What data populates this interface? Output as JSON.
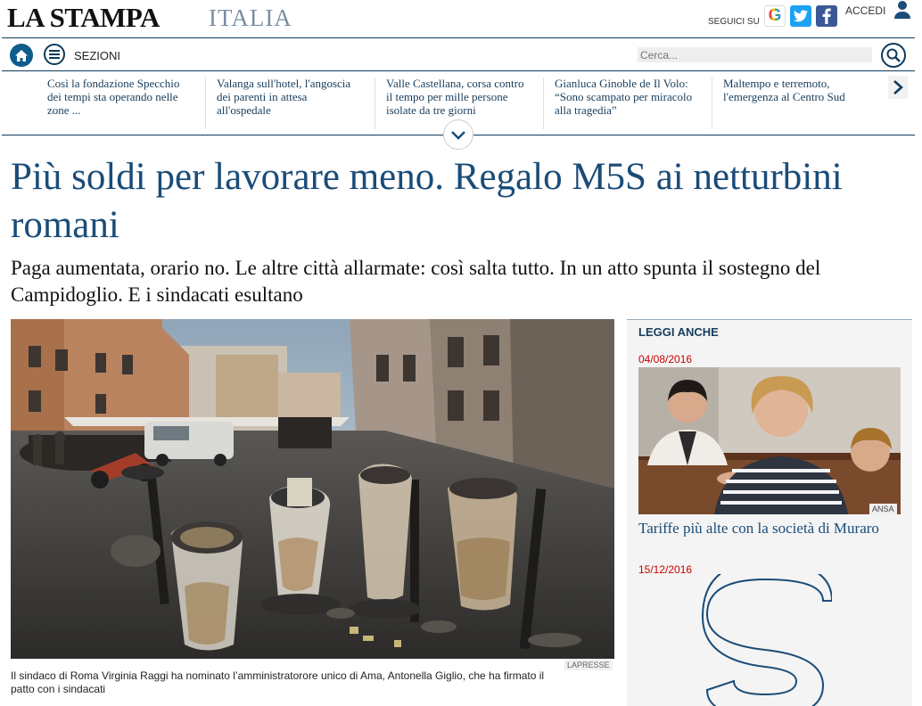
{
  "brand": {
    "logo": "LA STAMPA",
    "section": "ITALIA"
  },
  "social": {
    "follow_label": "SEGUICI SU",
    "icons": [
      "google-icon",
      "twitter-icon",
      "facebook-icon"
    ]
  },
  "account": {
    "login_label": "ACCEDI"
  },
  "nav": {
    "sections_label": "SEZIONI",
    "search_placeholder": "Cerca..."
  },
  "ticker": [
    "Così la fondazione Specchio dei tempi sta operando nelle zone ...",
    "Valanga sull'hotel, l'angoscia dei parenti in attesa all'ospedale",
    "Valle Castellana, corsa contro il tempo per mille persone isolate da tre giorni",
    "Gianluca Ginoble de Il Volo: “Sono scampato per miracolo alla tragedia”",
    "Maltempo e terremoto, l'emergenza al Centro Sud"
  ],
  "article": {
    "headline": "Più soldi per lavorare meno. Regalo M5S ai netturbini romani",
    "subheadline": "Paga aumentata, orario no. Le altre città allarmate: così salta tutto. In un atto spunta il sostegno del Campidoglio. E i sindacati esultano",
    "photo_credit": "LAPRESSE",
    "caption": "Il sindaco di Roma Virginia Raggi ha nominato l’amministratorore unico di Ama, Antonella Giglio, che ha firmato il patto con i sindacati"
  },
  "sidebar": {
    "title": "LEGGI ANCHE",
    "items": [
      {
        "date": "04/08/2016",
        "credit": "ANSA",
        "title": "Tariffe più alte con la società di Muraro"
      },
      {
        "date": "15/12/2016"
      }
    ]
  },
  "colors": {
    "brand_blue": "#1a4c78",
    "nav_navy": "#0d3a5c",
    "date_red": "#cc0000"
  }
}
